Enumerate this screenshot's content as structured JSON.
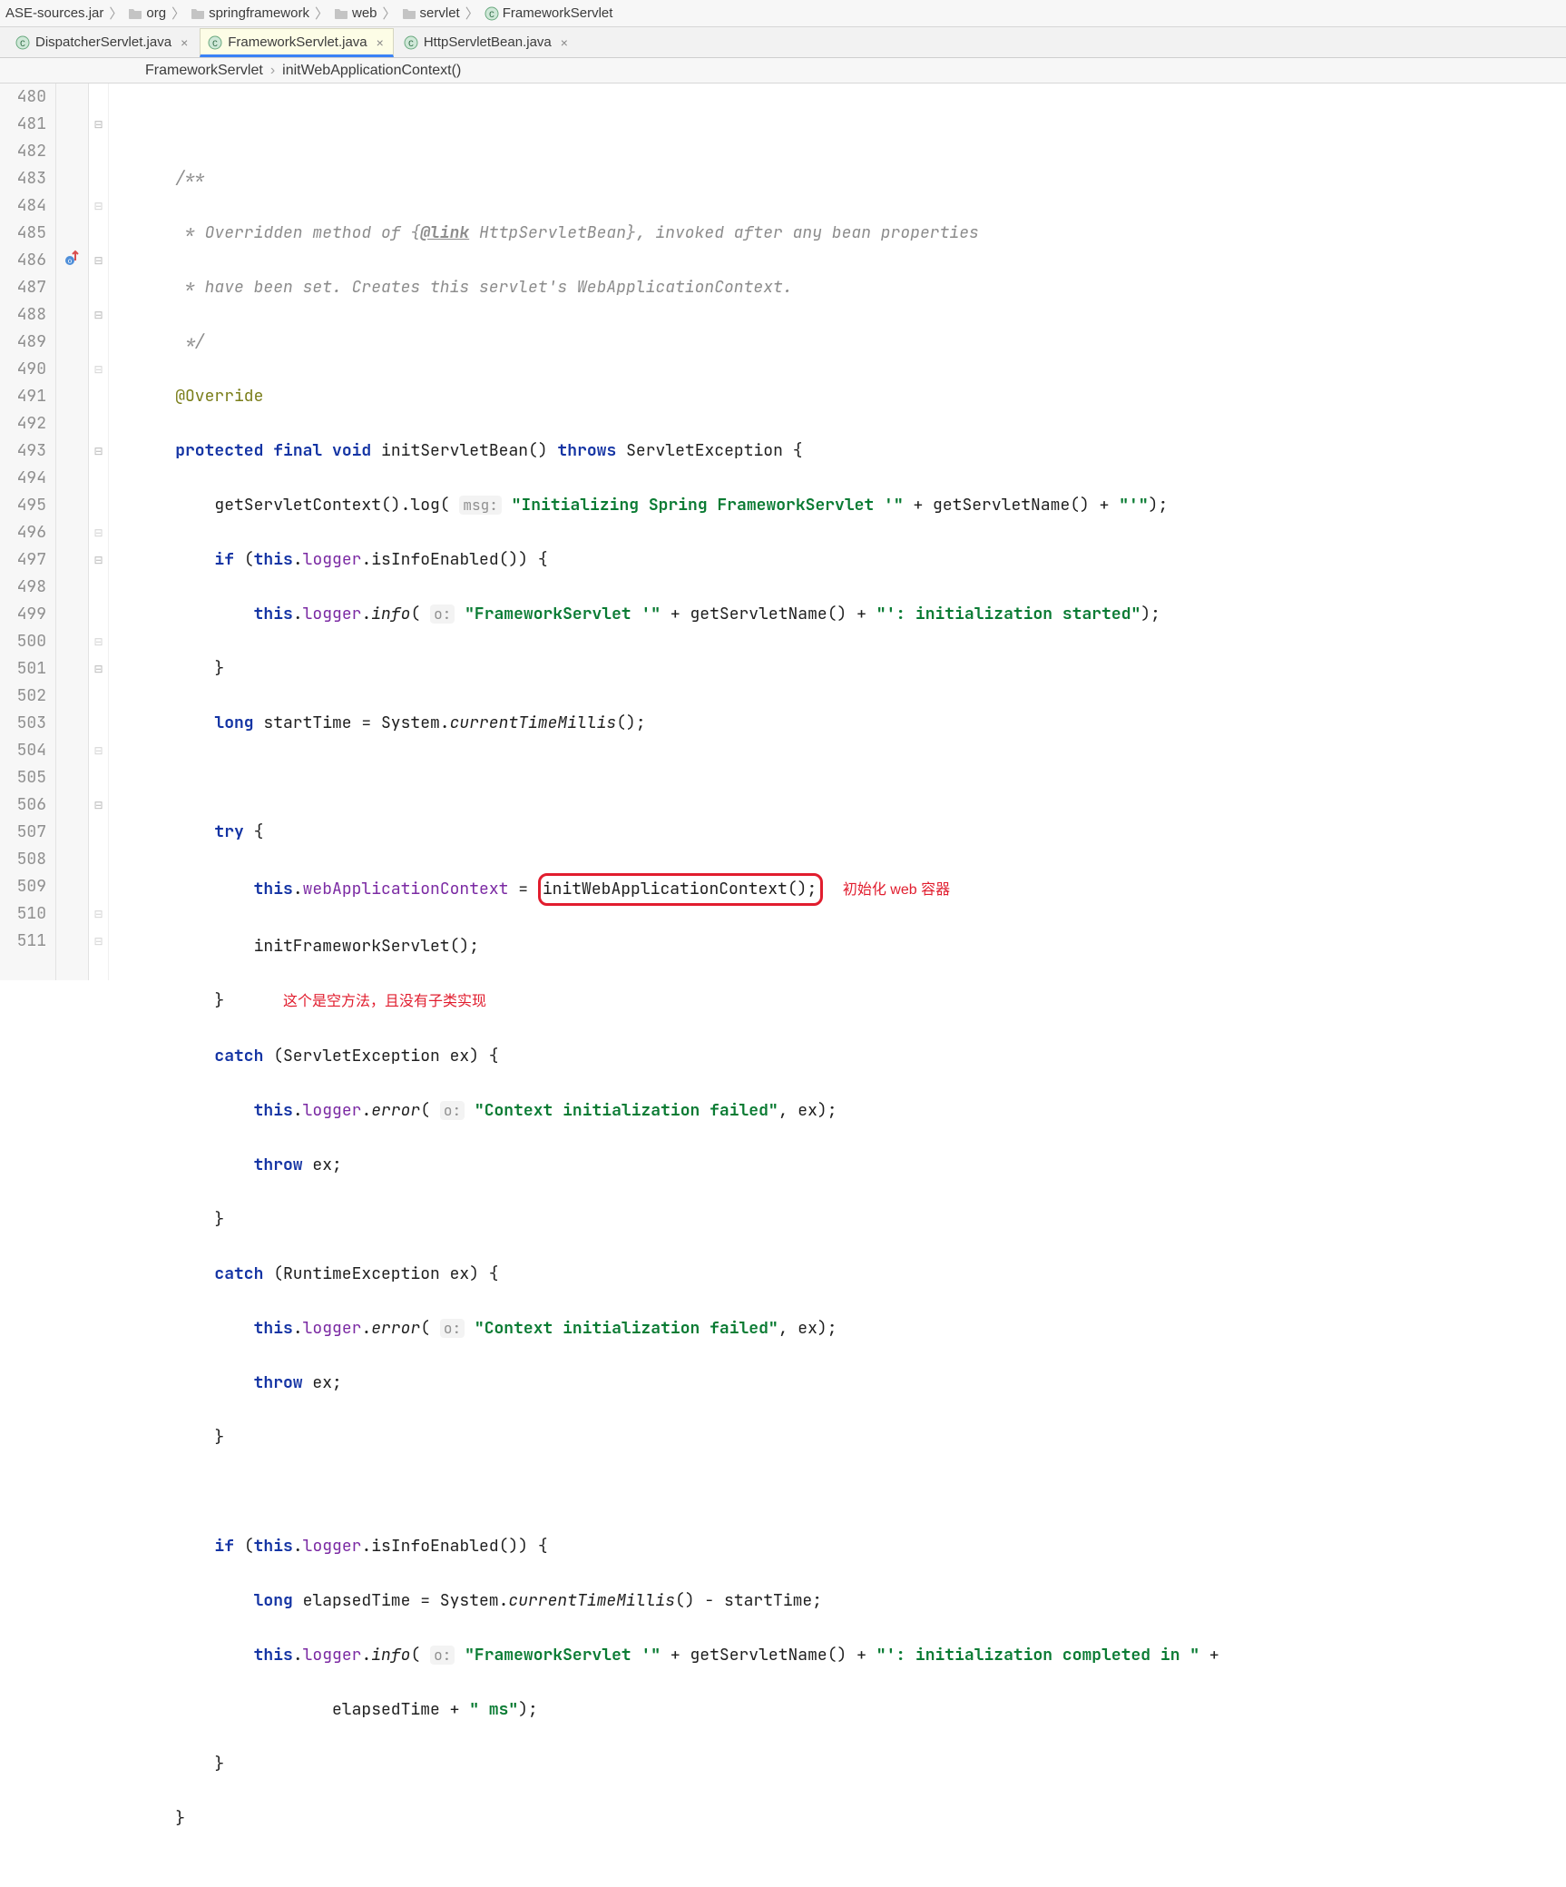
{
  "breadcrumbs": [
    {
      "label": "ASE-sources.jar",
      "icon": "none"
    },
    {
      "label": "org",
      "icon": "folder"
    },
    {
      "label": "springframework",
      "icon": "folder"
    },
    {
      "label": "web",
      "icon": "folder"
    },
    {
      "label": "servlet",
      "icon": "folder"
    },
    {
      "label": "FrameworkServlet",
      "icon": "class"
    }
  ],
  "tabs": [
    {
      "label": "DispatcherServlet.java",
      "active": false
    },
    {
      "label": "FrameworkServlet.java",
      "active": true
    },
    {
      "label": "HttpServletBean.java",
      "active": false
    }
  ],
  "methodPath": {
    "cls": "FrameworkServlet",
    "mth": "initWebApplicationContext()"
  },
  "lineStart": 480,
  "lineEnd": 511,
  "annotations": {
    "redBoxText": "initWebApplicationContext();",
    "redSide": "初始化 web 容器",
    "redBelow": "这个是空方法，且没有子类实现"
  },
  "code": {
    "l480": "",
    "l481_cmt": "/**",
    "l482_cmt_a": " * Overridden method of {",
    "l482_link": "@link",
    "l482_cmt_b": " HttpServletBean}, invoked after any bean properties",
    "l483_cmt": " * have been set. Creates this servlet's WebApplicationContext.",
    "l484_cmt": " */",
    "l485_ann": "@Override",
    "l486_kw1": "protected",
    "l486_kw2": "final",
    "l486_kw3": "void",
    "l486_name": "initServletBean()",
    "l486_kw4": "throws",
    "l486_ex": "ServletException {",
    "l487_a": "getServletContext().log(",
    "l487_hint": "msg:",
    "l487_str": "\"Initializing Spring FrameworkServlet '\"",
    "l487_b": " + getServletName() + ",
    "l487_str2": "\"'\"",
    "l487_c": ");",
    "l488_kw": "if",
    "l488_body": " (",
    "l488_kw2": "this",
    "l488_b": ".",
    "l488_fld": "logger",
    "l488_c": ".isInfoEnabled()) {",
    "l489_kw": "this",
    "l489_a": ".",
    "l489_fld": "logger",
    "l489_b": ".",
    "l489_mth": "info",
    "l489_c": "(",
    "l489_hint": "o:",
    "l489_str": "\"FrameworkServlet '\"",
    "l489_d": " + getServletName() + ",
    "l489_str2": "\"': initialization started\"",
    "l489_e": ");",
    "l490": "}",
    "l491_kw": "long",
    "l491_a": " startTime = System.",
    "l491_mth": "currentTimeMillis",
    "l491_b": "();",
    "l492": "",
    "l493_kw": "try",
    "l493_a": " {",
    "l494_kw": "this",
    "l494_a": ".",
    "l494_fld": "webApplicationContext",
    "l494_b": " = ",
    "l495_a": "initFrameworkServlet();",
    "l496": "}",
    "l497_kw": "catch",
    "l497_a": " (ServletException ex) {",
    "l498_kw": "this",
    "l498_a": ".",
    "l498_fld": "logger",
    "l498_b": ".",
    "l498_mth": "error",
    "l498_c": "(",
    "l498_hint": "o:",
    "l498_str": "\"Context initialization failed\"",
    "l498_d": ", ex);",
    "l499_kw": "throw",
    "l499_a": " ex;",
    "l500": "}",
    "l501_kw": "catch",
    "l501_a": " (RuntimeException ex) {",
    "l502_kw": "this",
    "l502_a": ".",
    "l502_fld": "logger",
    "l502_b": ".",
    "l502_mth": "error",
    "l502_c": "(",
    "l502_hint": "o:",
    "l502_str": "\"Context initialization failed\"",
    "l502_d": ", ex);",
    "l503_kw": "throw",
    "l503_a": " ex;",
    "l504": "}",
    "l505": "",
    "l506_kw": "if",
    "l506_a": " (",
    "l506_kw2": "this",
    "l506_b": ".",
    "l506_fld": "logger",
    "l506_c": ".isInfoEnabled()) {",
    "l507_kw": "long",
    "l507_a": " elapsedTime = System.",
    "l507_mth": "currentTimeMillis",
    "l507_b": "() - startTime;",
    "l508_kw": "this",
    "l508_a": ".",
    "l508_fld": "logger",
    "l508_b": ".",
    "l508_mth": "info",
    "l508_c": "(",
    "l508_hint": "o:",
    "l508_str": "\"FrameworkServlet '\"",
    "l508_d": " + getServletName() + ",
    "l508_str2": "\"': initialization completed in \"",
    "l508_e": " +",
    "l509_a": "elapsedTime + ",
    "l509_str": "\" ms\"",
    "l509_b": ");",
    "l510": "}",
    "l511": "}"
  }
}
